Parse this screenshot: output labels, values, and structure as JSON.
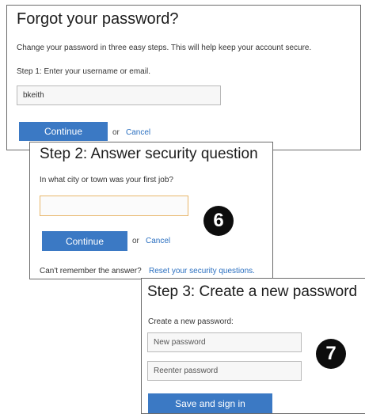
{
  "step1": {
    "title": "Forgot your password?",
    "description": "Change your password in three easy steps. This will help keep your account secure.",
    "field_label": "Step 1: Enter your username or email.",
    "username_value": "bkeith",
    "continue_label": "Continue",
    "or_text": "or",
    "cancel_label": "Cancel"
  },
  "step2": {
    "title": "Step 2: Answer security question",
    "question": "In what city or town was your first job?",
    "answer_value": "",
    "continue_label": "Continue",
    "or_text": "or",
    "cancel_label": "Cancel",
    "help_text": "Can't remember the answer?",
    "reset_link": "Reset your security questions."
  },
  "step3": {
    "title": "Step 3: Create a new password",
    "label": "Create a new password:",
    "new_password_placeholder": "New password",
    "reenter_placeholder": "Reenter password",
    "save_label": "Save and sign in"
  },
  "callouts": {
    "badge_6": "6",
    "badge_7": "7"
  },
  "colors": {
    "button": "#3b79c4",
    "link": "#2a6fc0",
    "focus_border": "#e8b66a"
  }
}
